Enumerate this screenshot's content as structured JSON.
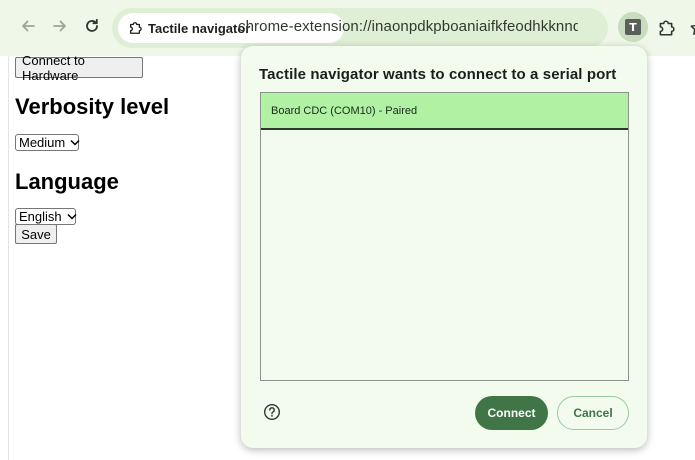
{
  "browser": {
    "site_chip_label": "Tactile navigator",
    "url": "chrome-extension://inaonpdkpboaniaifkfeodhkknndbpm...",
    "extension_badge": "T"
  },
  "page": {
    "connect_button": "Connect to Hardware",
    "verbosity_heading": "Verbosity level",
    "verbosity_selected": "Medium",
    "language_heading": "Language",
    "language_selected": "English",
    "save_button": "Save"
  },
  "dialog": {
    "title": "Tactile navigator wants to connect to a serial port",
    "ports": [
      {
        "label": "Board CDC (COM10) - Paired",
        "selected": true
      }
    ],
    "connect_button": "Connect",
    "cancel_button": "Cancel"
  },
  "colors": {
    "toolbar_bg": "#eef7e8",
    "dialog_bg": "#f3fbef",
    "selected_row": "#b0f1a4",
    "accent": "#3f7547"
  }
}
